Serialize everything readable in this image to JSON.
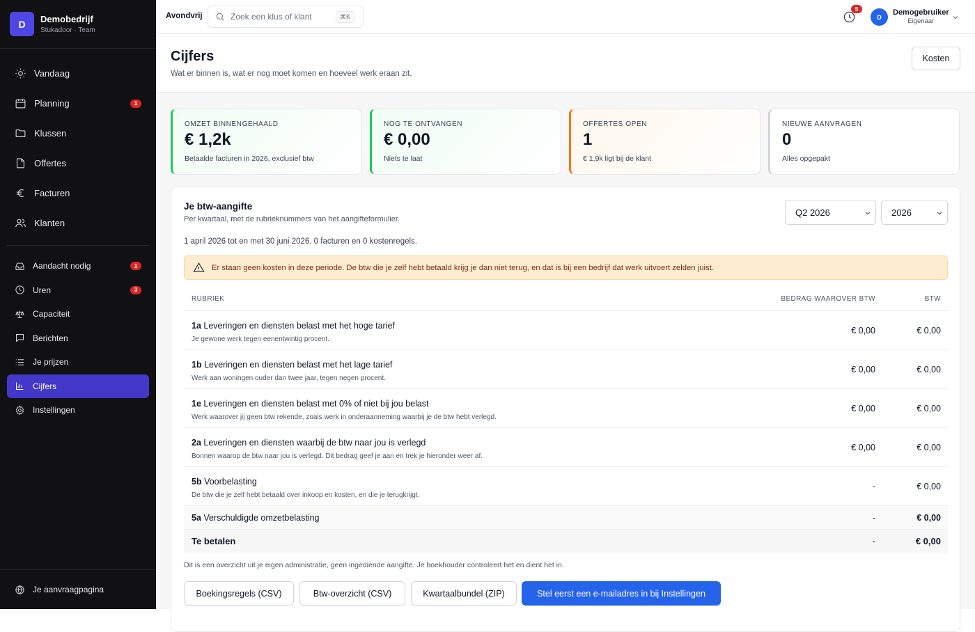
{
  "company": {
    "initial": "D",
    "name": "Demobedrijf",
    "subtitle": "Stukadoor · Team"
  },
  "nav_main": [
    {
      "label": "Vandaag",
      "icon": "sun-icon"
    },
    {
      "label": "Planning",
      "icon": "calendar-icon",
      "badge": "1"
    },
    {
      "label": "Klussen",
      "icon": "folder-icon"
    },
    {
      "label": "Offertes",
      "icon": "file-icon"
    },
    {
      "label": "Facturen",
      "icon": "euro-icon"
    },
    {
      "label": "Klanten",
      "icon": "users-icon"
    }
  ],
  "nav_secondary": [
    {
      "label": "Aandacht nodig",
      "icon": "inbox-icon",
      "badge": "1"
    },
    {
      "label": "Uren",
      "icon": "clock-icon",
      "badge": "3"
    },
    {
      "label": "Capaciteit",
      "icon": "scale-icon"
    },
    {
      "label": "Berichten",
      "icon": "message-icon"
    },
    {
      "label": "Je prijzen",
      "icon": "list-icon"
    },
    {
      "label": "Cijfers",
      "icon": "chart-icon",
      "active": true
    },
    {
      "label": "Instellingen",
      "icon": "gear-icon"
    }
  ],
  "nav_footer": {
    "label": "Je aanvraagpagina",
    "icon": "globe-icon"
  },
  "topbar": {
    "company": "Avondvrij",
    "search_placeholder": "Zoek een klus of klant",
    "search_shortcut": "⌘K",
    "notification_count": "5",
    "user_initial": "D",
    "user_name": "Demogebruiker",
    "user_role": "Eigenaar"
  },
  "page": {
    "title": "Cijfers",
    "subtitle": "Wat er binnen is, wat er nog moet komen en hoeveel werk eraan zit.",
    "action_button": "Kosten"
  },
  "stats": [
    {
      "label": "OMZET BINNENGEHAALD",
      "value": "€ 1,2k",
      "note": "Betaalde facturen in 2026, exclusief btw",
      "accent": "#22c55e",
      "bg": "#f0fdf4"
    },
    {
      "label": "NOG TE ONTVANGEN",
      "value": "€ 0,00",
      "note": "Niets te laat",
      "accent": "#22c55e",
      "bg": "#f0fdf4"
    },
    {
      "label": "OFFERTES OPEN",
      "value": "1",
      "note": "€ 1,9k ligt bij de klant",
      "accent": "#f97316",
      "bg": "#fff7ed"
    },
    {
      "label": "NIEUWE AANVRAGEN",
      "value": "0",
      "note": "Alles opgepakt",
      "accent": "#d1d5db",
      "bg": "#ffffff"
    }
  ],
  "vat": {
    "title": "Je btw-aangifte",
    "subtitle": "Per kwartaal, met de rubrieknummers van het aangifteformulier.",
    "quarter": "Q2 2026",
    "year": "2026",
    "period": "1 april 2026 tot en met 30 juni 2026. 0 facturen en 0 kostenregels.",
    "warning": "Er staan geen kosten in deze periode. De btw die je zelf hebt betaald krijg je dan niet terug, en dat is bij een bedrijf dat werk uitvoert zelden juist.",
    "columns": {
      "rubriek": "RUBRIEK",
      "bedrag": "BEDRAG WAAROVER BTW",
      "btw": "BTW"
    },
    "rows": [
      {
        "code": "1a",
        "label": "Leveringen en diensten belast met het hoge tarief",
        "desc": "Je gewone werk tegen eenentwintig procent.",
        "bedrag": "€ 0,00",
        "btw": "€ 0,00"
      },
      {
        "code": "1b",
        "label": "Leveringen en diensten belast met het lage tarief",
        "desc": "Werk aan woningen ouder dan twee jaar, tegen negen procent.",
        "bedrag": "€ 0,00",
        "btw": "€ 0,00"
      },
      {
        "code": "1e",
        "label": "Leveringen en diensten belast met 0% of niet bij jou belast",
        "desc": "Werk waarover jij geen btw rekende, zoals werk in onderaanneming waarbij je de btw hebt verlegd.",
        "bedrag": "€ 0,00",
        "btw": "€ 0,00"
      },
      {
        "code": "2a",
        "label": "Leveringen en diensten waarbij de btw naar jou is verlegd",
        "desc": "Bonnen waarop de btw naar jou is verlegd. Dit bedrag geef je aan en trek je hieronder weer af.",
        "bedrag": "€ 0,00",
        "btw": "€ 0,00"
      },
      {
        "code": "5b",
        "label": "Voorbelasting",
        "desc": "De btw die je zelf hebt betaald over inkoop en kosten, en die je terugkrijgt.",
        "bedrag": "-",
        "btw": "€ 0,00"
      }
    ],
    "subtotal": {
      "code": "5a",
      "label": "Verschuldigde omzetbelasting",
      "bedrag": "-",
      "btw": "€ 0,00"
    },
    "total": {
      "label": "Te betalen",
      "bedrag": "-",
      "btw": "€ 0,00"
    },
    "footnote": "Dit is een overzicht uit je eigen administratie, geen ingediende aangifte. Je boekhouder controleert het en dient het in.",
    "buttons": [
      "Boekingsregels (CSV)",
      "Btw-overzicht (CSV)",
      "Kwartaalbundel (ZIP)",
      "Stel eerst een e-mailadres in bij Instellingen"
    ]
  }
}
